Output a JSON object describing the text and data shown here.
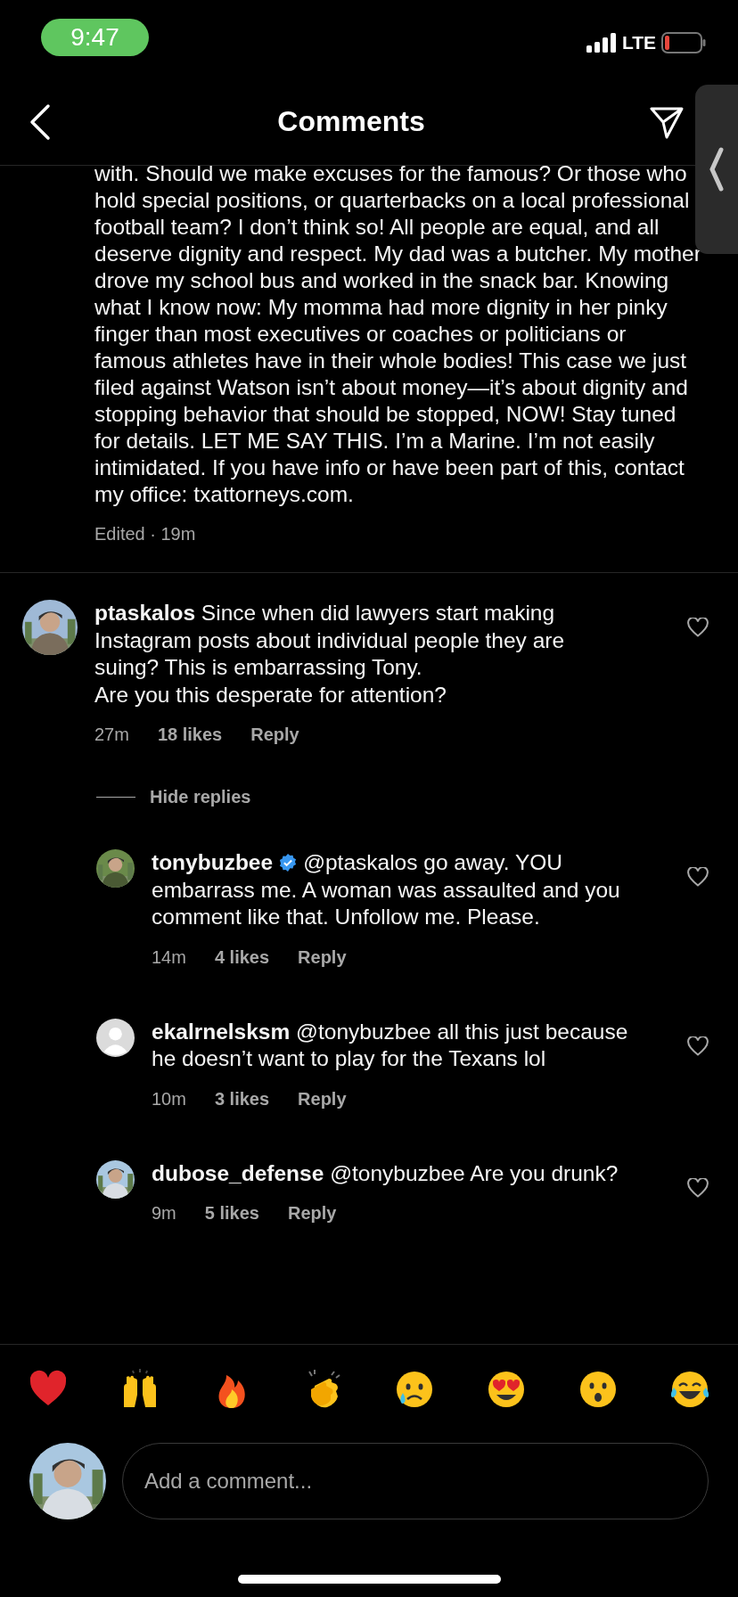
{
  "status_bar": {
    "time": "9:47",
    "network": "LTE"
  },
  "header": {
    "title": "Comments"
  },
  "caption": {
    "text": "with. Should we make excuses for the famous? Or those who hold special positions, or quarterbacks on a local professional football team? I don’t think so! All people are equal, and all deserve dignity and respect. My dad was a butcher. My mother drove my school bus and worked in the snack bar. Knowing what I know now: My momma had more dignity in her pinky finger than most executives or coaches or politicians or famous athletes have in their whole bodies! This case we just filed against Watson isn’t about money—it’s about dignity and stopping behavior that should be stopped, NOW! Stay tuned for details. LET ME SAY THIS. I’m a Marine. I’m not easily intimidated. If you have info or have been part of this, contact my office: txattorneys.com.",
    "meta": "Edited · 19m"
  },
  "comments": [
    {
      "username": "ptaskalos",
      "verified": false,
      "text": "Since when did lawyers start making Instagram posts about individual people they are suing? This is embarrassing Tony.\nAre you this desperate for attention?",
      "time": "27m",
      "likes": "18 likes",
      "reply": "Reply",
      "liked": false,
      "replies_toggle": "Hide replies",
      "replies": [
        {
          "username": "tonybuzbee",
          "verified": true,
          "text": "@ptaskalos go away. YOU embarrass me. A woman was assaulted and you comment like that. Unfollow me. Please.",
          "time": "14m",
          "likes": "4 likes",
          "reply": "Reply",
          "liked": false
        },
        {
          "avatar": {
            "kind": "default"
          },
          "username": "ekalrnelsksm",
          "verified": false,
          "text": "@tonybuzbee all this just because he doesn’t want to play for the Texans lol",
          "time": "10m",
          "likes": "3 likes",
          "reply": "Reply",
          "liked": false
        },
        {
          "username": "dubose_defense",
          "verified": false,
          "text": "@tonybuzbee Are you drunk?",
          "time": "9m",
          "likes": "5 likes",
          "reply": "Reply",
          "liked": false
        }
      ]
    }
  ],
  "reactions": [
    {
      "kind": "heart"
    },
    {
      "kind": "raised-hands"
    },
    {
      "kind": "fire"
    },
    {
      "kind": "clap"
    },
    {
      "kind": "crying"
    },
    {
      "kind": "heart-eyes"
    },
    {
      "kind": "surprised"
    },
    {
      "kind": "joy"
    }
  ],
  "composer": {
    "placeholder": "Add a comment..."
  }
}
